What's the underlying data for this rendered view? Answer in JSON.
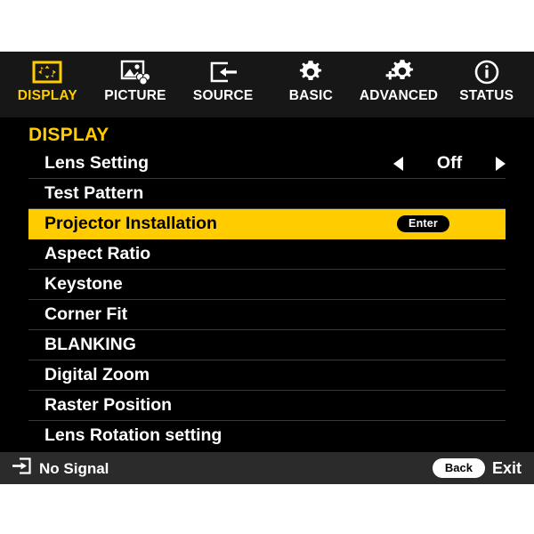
{
  "osd": {
    "accent_color": "#FFCC00",
    "background_color": "#000000",
    "tab_bar_color": "#171717",
    "status_bar_color": "#2B2B2B",
    "separator_color": "#3A3A3A"
  },
  "tabs": [
    {
      "label": "DISPLAY",
      "icon": "display-shift-icon",
      "active": true
    },
    {
      "label": "PICTURE",
      "icon": "picture-image-icon",
      "active": false
    },
    {
      "label": "SOURCE",
      "icon": "source-input-icon",
      "active": false
    },
    {
      "label": "BASIC",
      "icon": "gear-icon",
      "active": false
    },
    {
      "label": "ADVANCED",
      "icon": "gear-plus-icon",
      "active": false
    },
    {
      "label": "STATUS",
      "icon": "info-circle-icon",
      "active": false
    }
  ],
  "menu": {
    "title": "DISPLAY",
    "rows": [
      {
        "label": "Lens Setting",
        "control": "stepper",
        "value": "Off",
        "selected": false
      },
      {
        "label": "Test Pattern",
        "control": "none",
        "value": "",
        "selected": false
      },
      {
        "label": "Projector Installation",
        "control": "enter",
        "value": "Enter",
        "selected": true
      },
      {
        "label": "Aspect Ratio",
        "control": "none",
        "value": "",
        "selected": false
      },
      {
        "label": "Keystone",
        "control": "none",
        "value": "",
        "selected": false
      },
      {
        "label": "Corner Fit",
        "control": "none",
        "value": "",
        "selected": false
      },
      {
        "label": "BLANKING",
        "control": "none",
        "value": "",
        "selected": false
      },
      {
        "label": "Digital Zoom",
        "control": "none",
        "value": "",
        "selected": false
      },
      {
        "label": "Raster Position",
        "control": "none",
        "value": "",
        "selected": false
      },
      {
        "label": "Lens Rotation setting",
        "control": "none",
        "value": "",
        "selected": false
      }
    ]
  },
  "status_bar": {
    "signal_icon": "input-signal-icon",
    "signal_text": "No Signal",
    "back_label": "Back",
    "exit_label": "Exit"
  }
}
